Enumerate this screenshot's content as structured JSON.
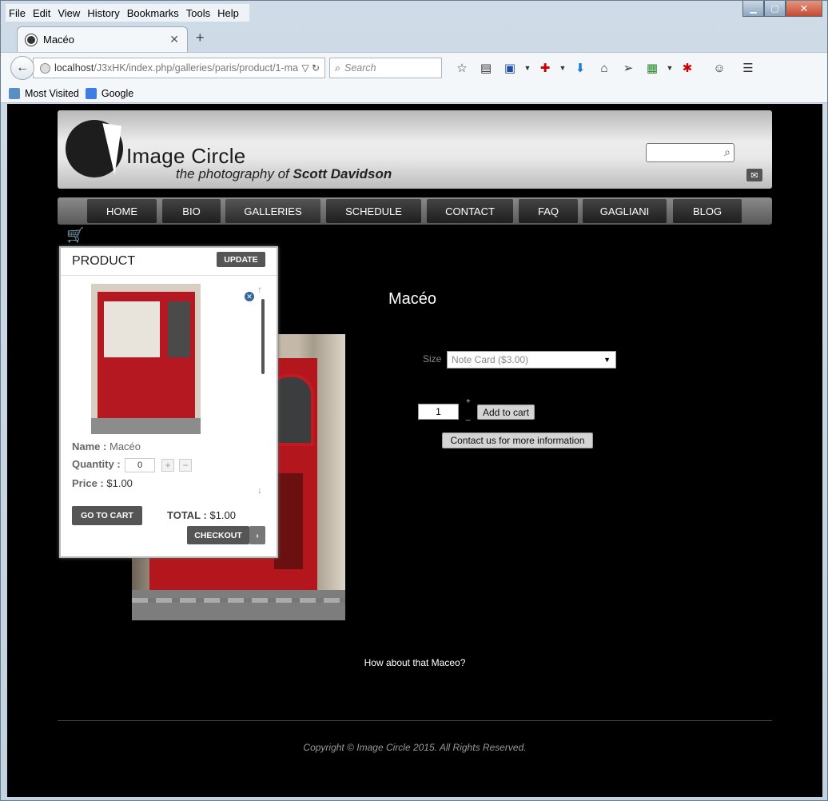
{
  "browser": {
    "menu": [
      "File",
      "Edit",
      "View",
      "History",
      "Bookmarks",
      "Tools",
      "Help"
    ],
    "tab_title": "Macéo",
    "url_host": "localhost",
    "url_path": "/J3xHK/index.php/galleries/paris/product/1-ma",
    "search_placeholder": "Search",
    "bookmarks": [
      "Most Visited",
      "Google"
    ]
  },
  "site": {
    "logo_title": "Image Circle",
    "logo_sub_prefix": "the photography of ",
    "logo_sub_name": "Scott Davidson",
    "nav": [
      "HOME",
      "BIO",
      "GALLERIES",
      "SCHEDULE",
      "CONTACT",
      "FAQ",
      "GAGLIANI",
      "BLOG"
    ],
    "active_nav": "GALLERIES"
  },
  "cart_popup": {
    "title": "PRODUCT",
    "update_label": "UPDATE",
    "name_label": "Name :",
    "name_value": "Macéo",
    "quantity_label": "Quantity :",
    "quantity_value": "0",
    "price_label": "Price :",
    "price_value": "$1.00",
    "go_to_cart_label": "GO TO CART",
    "total_label": "TOTAL :",
    "total_value": "$1.00",
    "checkout_label": "CHECKOUT"
  },
  "product": {
    "title": "Macéo",
    "size_label": "Size",
    "size_selected": "Note Card ($3.00)",
    "quantity": "1",
    "add_to_cart_label": "Add to cart",
    "contact_label": "Contact us for more information",
    "caption": "How about that Maceo?"
  },
  "footer": {
    "copyright": "Copyright © Image Circle 2015. All Rights Reserved."
  },
  "colors": {
    "page_bg": "#000000",
    "nav_button": "#2a2a2a",
    "door_red": "#b3161c"
  }
}
